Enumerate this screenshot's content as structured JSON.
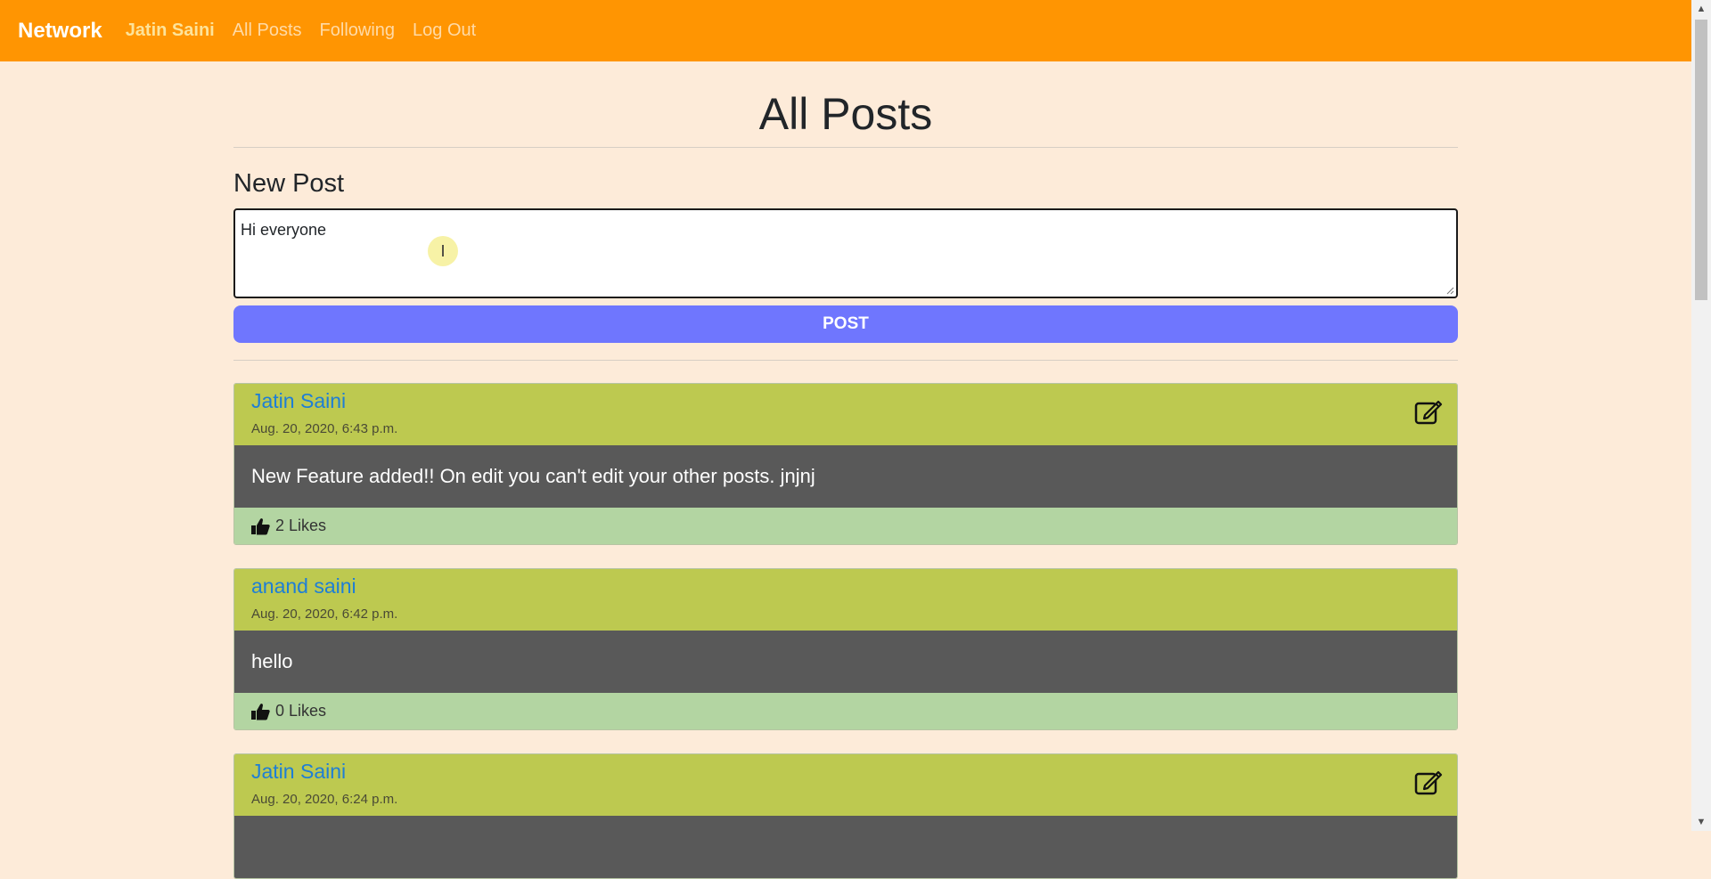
{
  "navbar": {
    "brand": "Network",
    "user": "Jatin Saini",
    "links": [
      "All Posts",
      "Following",
      "Log Out"
    ]
  },
  "page": {
    "title": "All Posts",
    "new_post_heading": "New Post",
    "textarea_value": "Hi everyone",
    "post_button": "POST"
  },
  "posts": [
    {
      "author": "Jatin Saini",
      "date": "Aug. 20, 2020, 6:43 p.m.",
      "content": "New Feature added!! On edit you can't edit your other posts. jnjnj",
      "likes": "2 Likes",
      "editable": true
    },
    {
      "author": "anand saini",
      "date": "Aug. 20, 2020, 6:42 p.m.",
      "content": "hello",
      "likes": "0 Likes",
      "editable": false
    },
    {
      "author": "Jatin Saini",
      "date": "Aug. 20, 2020, 6:24 p.m.",
      "content": "",
      "likes": "",
      "editable": true
    }
  ],
  "icons": {
    "edit": "edit-icon",
    "like": "thumbs-up-icon",
    "cursor": "text-cursor-icon"
  },
  "colors": {
    "navbar": "#ff9502",
    "background": "#fdebd9",
    "post_button": "#6f76fe",
    "post_header": "#bdc950",
    "post_body": "#595959",
    "post_footer": "#b3d5a2",
    "author_link": "#1e7ed6"
  }
}
